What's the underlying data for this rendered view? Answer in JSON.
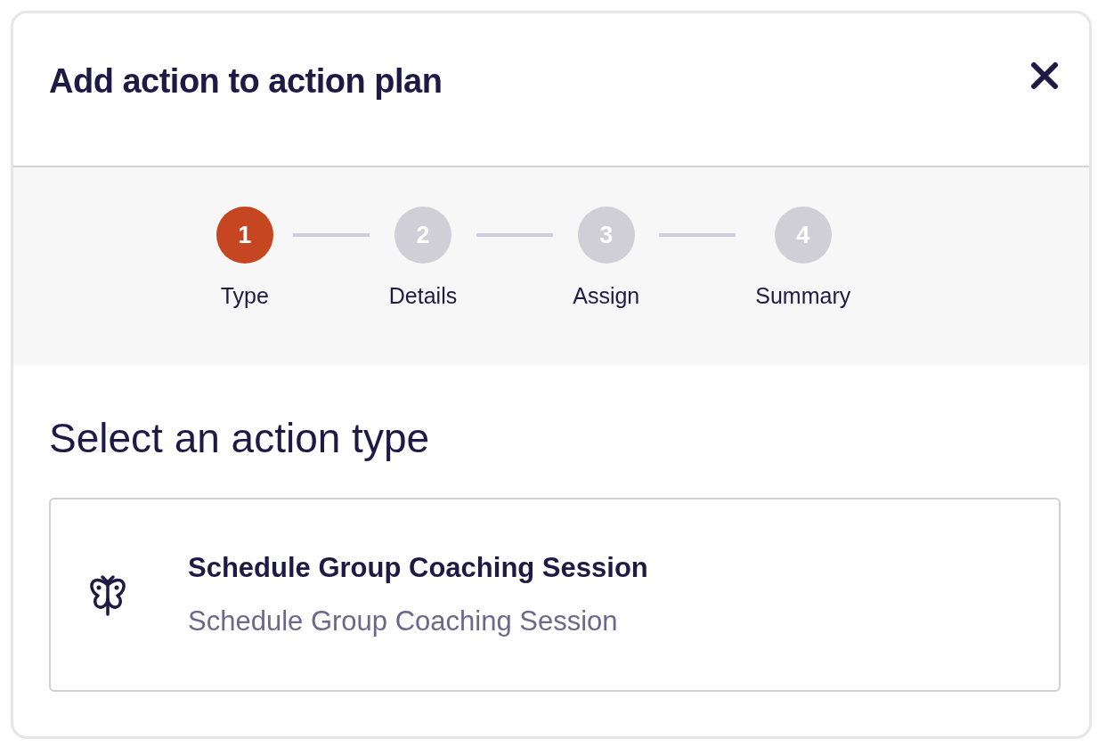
{
  "dialog": {
    "title": "Add action to action plan"
  },
  "steps": [
    {
      "number": "1",
      "label": "Type",
      "selected": true
    },
    {
      "number": "2",
      "label": "Details",
      "selected": false
    },
    {
      "number": "3",
      "label": "Assign",
      "selected": false
    },
    {
      "number": "4",
      "label": "Summary",
      "selected": false
    }
  ],
  "section_title": "Select an action type",
  "action_types": [
    {
      "title": "Schedule Group Coaching Session",
      "description": "Schedule Group Coaching Session",
      "selected": false
    }
  ]
}
